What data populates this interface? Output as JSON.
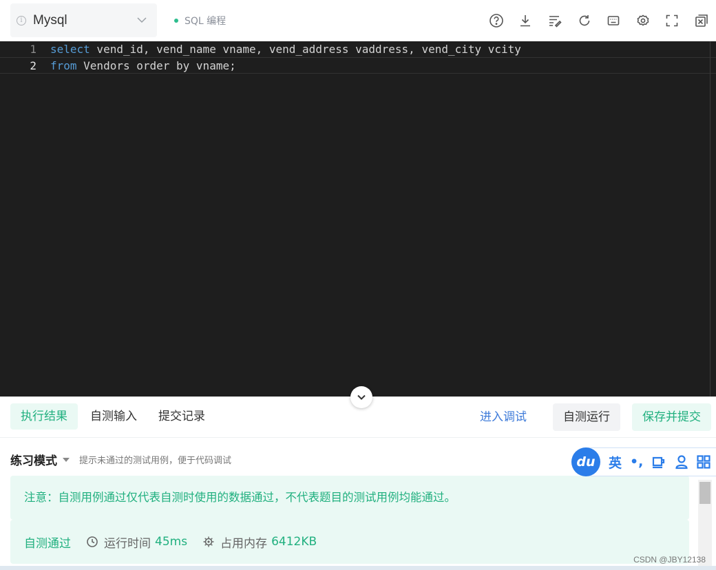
{
  "toolbar": {
    "language": "Mysql",
    "mode_label": "SQL 编程",
    "icons": [
      "help-icon",
      "download-icon",
      "format-icon",
      "reset-icon",
      "keyboard-icon",
      "settings-icon",
      "fullscreen-icon",
      "close-window-icon"
    ]
  },
  "editor": {
    "lines": [
      {
        "number": "1",
        "keyword": "select",
        "rest": " vend_id, vend_name vname, vend_address vaddress, vend_city vcity"
      },
      {
        "number": "2",
        "keyword": "from",
        "rest": " Vendors order by vname;"
      }
    ]
  },
  "tabs": {
    "result": "执行结果",
    "custom_input": "自测输入",
    "history": "提交记录"
  },
  "actions": {
    "debug": "进入调试",
    "run": "自测运行",
    "submit": "保存并提交"
  },
  "results": {
    "mode_title": "练习模式",
    "mode_hint": "提示未通过的测试用例，便于代码调试",
    "notice": "注意：自测用例通过仅代表自测时使用的数据通过，不代表题目的测试用例均能通过。",
    "status": "自测通过",
    "runtime_label": "运行时间",
    "runtime_value": "45ms",
    "memory_label": "占用内存",
    "memory_value": "6412KB"
  },
  "ime": {
    "logo": "du",
    "lang": "英",
    "punct": "•,"
  },
  "watermark": "CSDN @JBY12138",
  "colors": {
    "accent_green": "#21b07f",
    "link_blue": "#3e7bd9",
    "editor_bg": "#1e1e1e",
    "keyword": "#569cd6"
  }
}
